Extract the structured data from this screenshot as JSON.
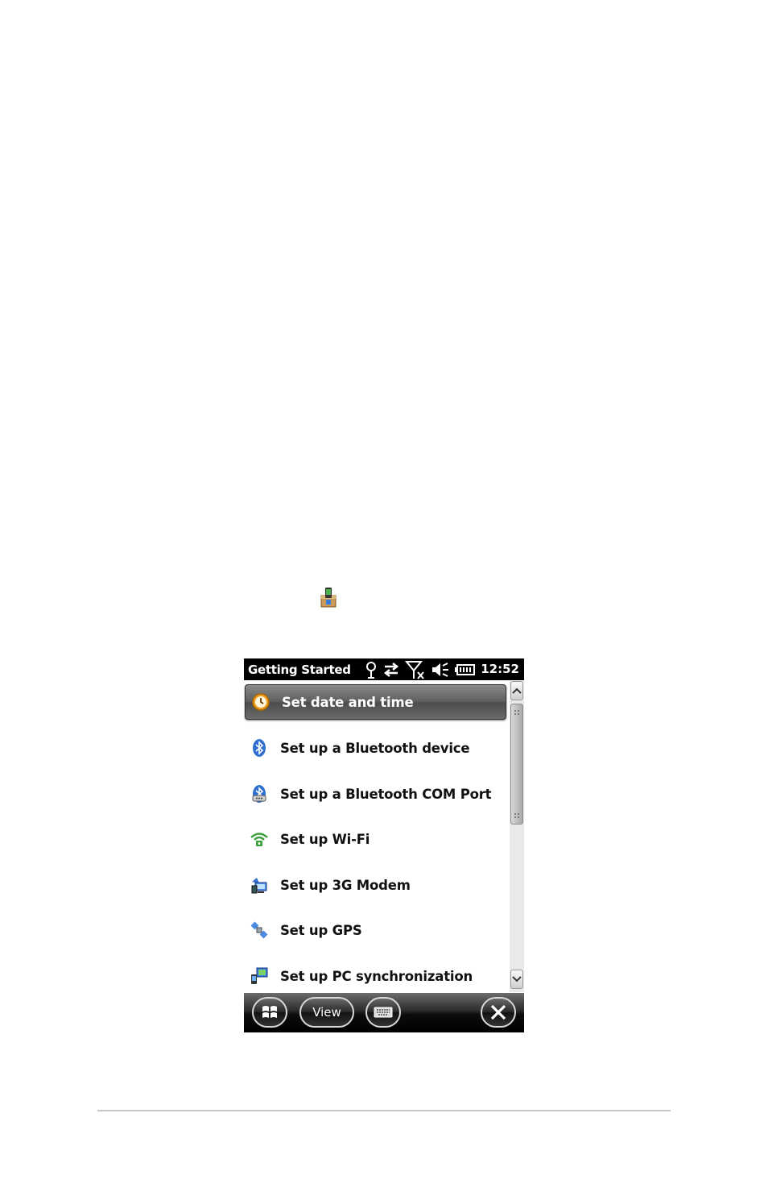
{
  "status_bar": {
    "title": "Getting Started",
    "clock": "12:52",
    "icons": [
      "connectivity-icon",
      "data-transfer-icon",
      "no-signal-icon",
      "speaker-icon",
      "battery-icon"
    ]
  },
  "list": {
    "items": [
      {
        "label": "Set date and time",
        "icon": "clock-icon",
        "selected": true
      },
      {
        "label": "Set up a Bluetooth device",
        "icon": "bluetooth-icon"
      },
      {
        "label": "Set up a Bluetooth COM Port",
        "icon": "bluetooth-com-icon"
      },
      {
        "label": "Set up Wi-Fi",
        "icon": "wifi-icon"
      },
      {
        "label": "Set up 3G Modem",
        "icon": "modem-icon"
      },
      {
        "label": "Set up GPS",
        "icon": "gps-icon"
      },
      {
        "label": "Set up PC synchronization",
        "icon": "pc-sync-icon"
      }
    ]
  },
  "softkeys": {
    "start": "windows-start-icon",
    "view_label": "View",
    "keyboard": "keyboard-icon",
    "close": "close-icon"
  },
  "colors": {
    "status_bar_bg": "#000000",
    "selection": "#5c5c5c",
    "bluetooth": "#2f6fd0",
    "wifi": "#3aa03a",
    "clock": "#f0a020"
  }
}
